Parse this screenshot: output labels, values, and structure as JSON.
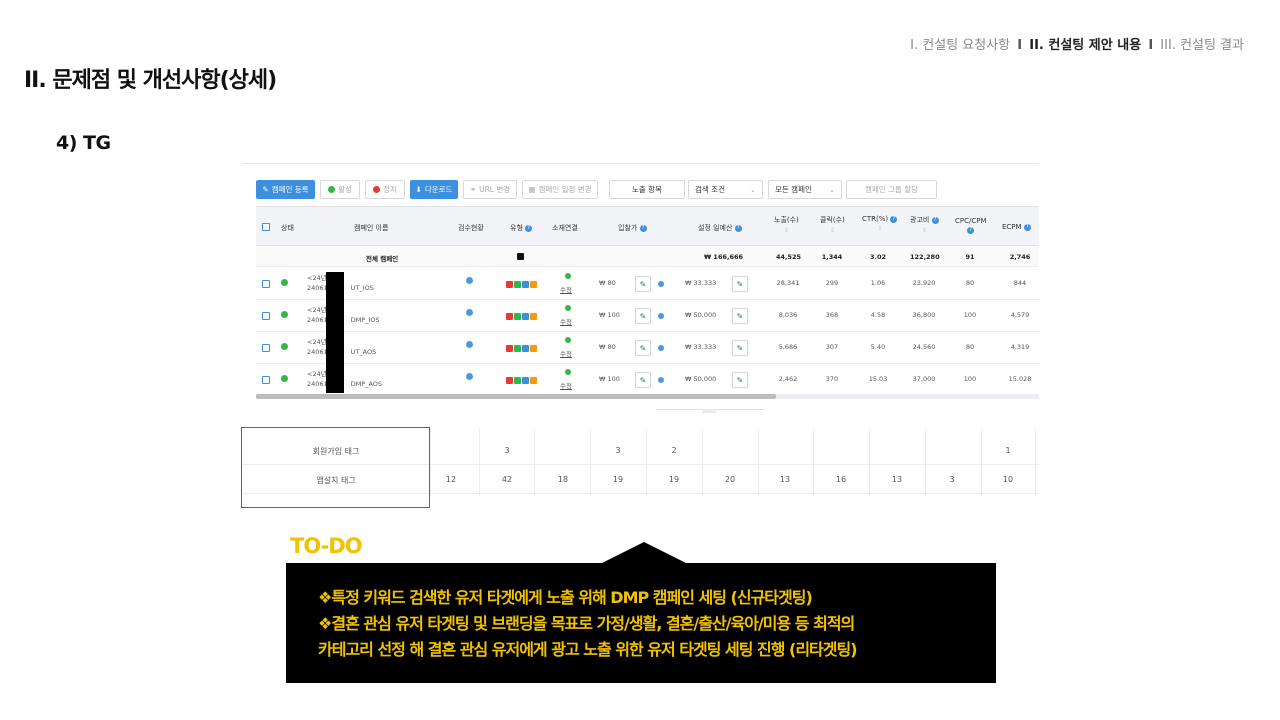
{
  "breadcrumb": {
    "item1": "I. 컨설팅 요청사항",
    "sep": "I",
    "item2": "II. 컨설팅 제안 내용",
    "item3": "III. 컨설팅 결과"
  },
  "page_title": "II. 문제점 및 개선사항(상세)",
  "section_title": "4) TG",
  "toolbar": {
    "register": "캠페인 등록",
    "on": "활성",
    "off": "정지",
    "download": "다운로드",
    "url_change": "URL 변경",
    "schedule_change": "캠페인 일정 변경",
    "exposure": "노출 항목",
    "search_condition": "검색 조건",
    "all_campaign": "모든 캠페인",
    "group_assign": "캠페인 그룹 할당"
  },
  "table": {
    "headers": {
      "status": "상태",
      "name": "캠페인 이름",
      "review": "검수현황",
      "type": "유형",
      "creative": "소재연결",
      "bid": "입찰가",
      "daily_budget": "설정 일예산",
      "impressions": "노출(수)",
      "clicks": "클릭(수)",
      "ctr": "CTR(%)",
      "ad_cost": "광고비",
      "cpc_cpm": "CPC/CPM",
      "ecpm": "ECPM"
    },
    "total": {
      "label": "전체 캠페인",
      "budget": "₩ 166,666",
      "impressions": "44,525",
      "clicks": "1,344",
      "ctr": "3.02",
      "ad_cost": "122,280",
      "cpc_cpm": "91",
      "ecpm": "2,746"
    },
    "rows": [
      {
        "name1": "<24년",
        "name2a": "24061",
        "name2b": "UT_IOS",
        "edit": "수정",
        "bid": "₩ 80",
        "budget": "₩ 33,333",
        "impressions": "28,341",
        "clicks": "299",
        "ctr": "1.06",
        "ad_cost": "23,920",
        "cpc_cpm": "80",
        "ecpm": "844"
      },
      {
        "name1": "<24년",
        "name2a": "24061",
        "name2b": "DMP_IOS",
        "edit": "수정",
        "bid": "₩ 100",
        "budget": "₩ 50,000",
        "impressions": "8,036",
        "clicks": "368",
        "ctr": "4.58",
        "ad_cost": "36,800",
        "cpc_cpm": "100",
        "ecpm": "4,579"
      },
      {
        "name1": "<24년",
        "name2a": "24061",
        "name2b": "UT_AOS",
        "edit": "수정",
        "bid": "₩ 80",
        "budget": "₩ 33,333",
        "impressions": "5,686",
        "clicks": "307",
        "ctr": "5.40",
        "ad_cost": "24,560",
        "cpc_cpm": "80",
        "ecpm": "4,319"
      },
      {
        "name1": "<24년",
        "name2a": "24061",
        "name2b": "DMP_AOS",
        "edit": "수정",
        "bid": "₩ 100",
        "budget": "₩ 50,000",
        "impressions": "2,462",
        "clicks": "370",
        "ctr": "15.03",
        "ad_cost": "37,000",
        "cpc_cpm": "100",
        "ecpm": "15,028"
      }
    ]
  },
  "tag_table": {
    "rows": [
      {
        "label": "회원가입 태그",
        "values": [
          "",
          "3",
          "",
          "3",
          "2",
          "",
          "",
          "",
          "",
          "",
          "1"
        ]
      },
      {
        "label": "앱설치 태그",
        "values": [
          "12",
          "42",
          "18",
          "19",
          "19",
          "20",
          "13",
          "16",
          "13",
          "3",
          "10"
        ]
      }
    ]
  },
  "todo": {
    "label": "TO-DO",
    "line1": "❖특정 키워드 검색한 유저 타겟에게 노출 위해 DMP 캠페인 세팅 (신규타겟팅)",
    "line2": "❖결혼 관심 유저 타겟팅 및 브랜딩을 목표로 가정/생활, 결혼/출산/육아/미용 등 최적의",
    "line3": "카테고리 선정 해 결혼 관심 유저에게 광고 노출 위한 유저 타겟팅 세팅 진행 (리타겟팅)"
  },
  "colors": {
    "accent_blue": "#3d8fe0",
    "active_green": "#35b54a",
    "stop_red": "#e53935",
    "todo_yellow": "#f2c200",
    "highlight_red": "#d9333a"
  }
}
